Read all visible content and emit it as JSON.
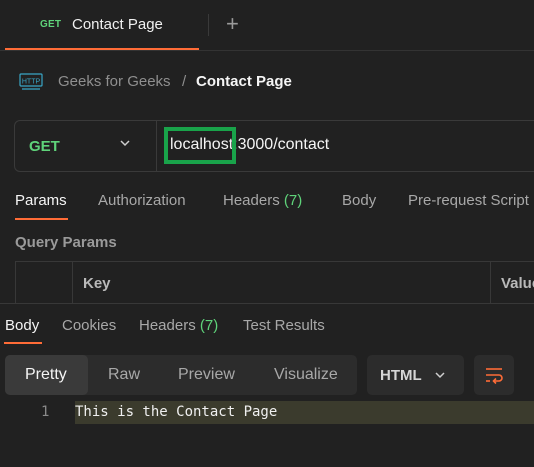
{
  "tab": {
    "method": "GET",
    "title": "Contact Page",
    "new_tab": "+"
  },
  "breadcrumb": {
    "icon": "http-icon",
    "parent": "Geeks for Geeks",
    "separator": "/",
    "current": "Contact Page"
  },
  "request": {
    "method": "GET",
    "url": "localhost:3000/contact"
  },
  "request_tabs": [
    {
      "label": "Params",
      "active": true
    },
    {
      "label": "Authorization"
    },
    {
      "label": "Headers",
      "count": "(7)"
    },
    {
      "label": "Body"
    },
    {
      "label": "Pre-request Script"
    }
  ],
  "query_params": {
    "title": "Query Params",
    "columns": [
      "Key",
      "Value"
    ]
  },
  "response_tabs": [
    {
      "label": "Body",
      "active": true
    },
    {
      "label": "Cookies"
    },
    {
      "label": "Headers",
      "count": "(7)"
    },
    {
      "label": "Test Results"
    }
  ],
  "view_modes": [
    "Pretty",
    "Raw",
    "Preview",
    "Visualize"
  ],
  "active_view_mode": "Pretty",
  "format": "HTML",
  "response_body": {
    "line_number": "1",
    "text": "This is the Contact Page"
  },
  "colors": {
    "accent": "#ff6c37",
    "method_get": "#5fd37a",
    "highlight_box": "#19a34a"
  }
}
